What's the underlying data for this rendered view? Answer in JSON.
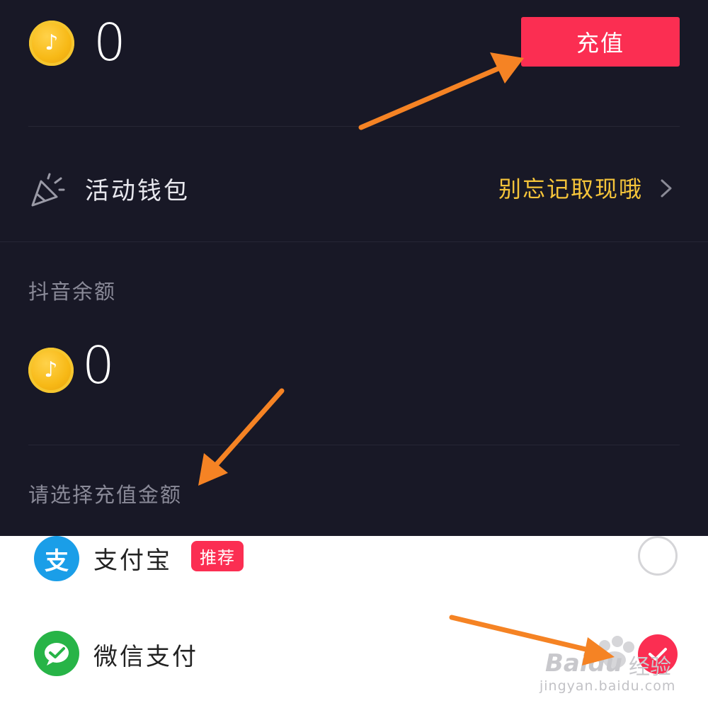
{
  "colors": {
    "background": "#181826",
    "accent": "#fb2e52",
    "hint": "#f5c43a",
    "arrow": "#f58324"
  },
  "top_balance": {
    "icon": "douyin-coin-icon",
    "value": "0"
  },
  "recharge_button": {
    "label": "充值"
  },
  "activity_wallet": {
    "icon": "party-popper-icon",
    "label": "活动钱包",
    "hint": "别忘记取现哦"
  },
  "douyin_balance": {
    "title": "抖音余额",
    "icon": "douyin-coin-icon",
    "value": "0"
  },
  "recharge_amount": {
    "title": "请选择充值金额"
  },
  "payment_methods": [
    {
      "icon": "alipay-icon",
      "icon_char": "支",
      "label": "支付宝",
      "badge": "推荐",
      "selected": false
    },
    {
      "icon": "wechat-pay-icon",
      "label": "微信支付",
      "selected": true
    }
  ],
  "watermark": {
    "brand": "Baidu",
    "suffix": "经验",
    "url": "jingyan.baidu.com"
  }
}
